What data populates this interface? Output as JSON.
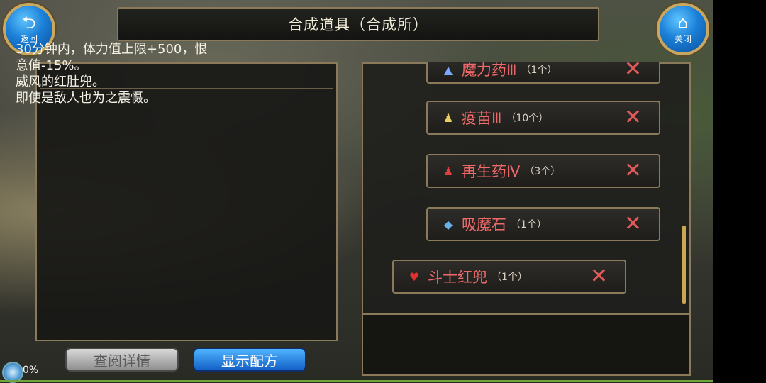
{
  "header": {
    "title": "合成道具（合成所）",
    "back_label": "返回",
    "close_label": "关闭",
    "back_icon": "back-arrow-icon",
    "close_icon": "home-icon"
  },
  "description": {
    "text": "30分钟内，体力值上限+500，恨\n意值-15%。\n威风的红肚兜。\n即使是敌人也为之震慑。"
  },
  "buttons": {
    "view_details": "查阅详情",
    "show_recipe": "显示配方"
  },
  "items": [
    {
      "name": "魔力药Ⅲ",
      "count": "（1个）",
      "icon": "potion-icon"
    },
    {
      "name": "疫苗Ⅲ",
      "count": "（10个）",
      "icon": "vial-icon"
    },
    {
      "name": "再生药Ⅳ",
      "count": "（3个）",
      "icon": "flask-icon"
    },
    {
      "name": "吸魔石",
      "count": "（1个）",
      "icon": "stone-icon"
    },
    {
      "name": "斗士红兜",
      "count": "（1个）",
      "icon": "red-bib-icon"
    }
  ],
  "status": {
    "loading_percent": "0%"
  },
  "colors": {
    "item_name": "#f06a6a",
    "accent_blue": "#1a7fd6",
    "frame": "#8a7a5a"
  }
}
